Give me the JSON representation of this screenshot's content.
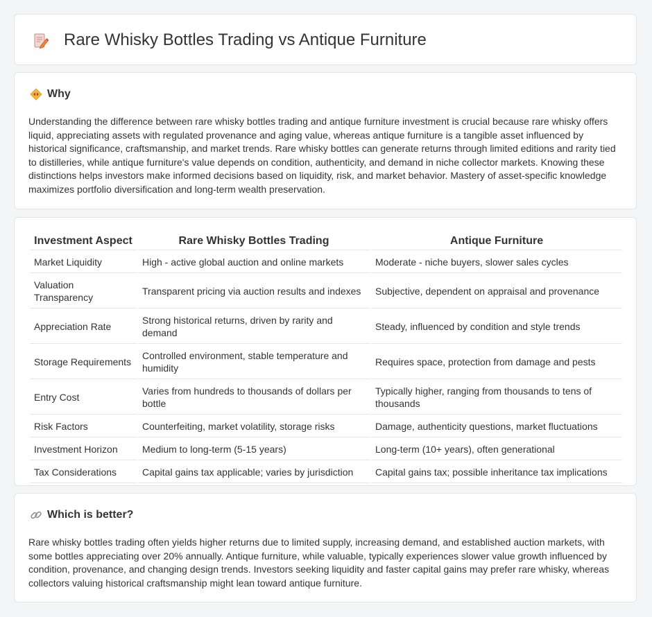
{
  "page": {
    "title": "Rare Whisky Bottles Trading vs Antique Furniture",
    "icon": "document-pencil-icon"
  },
  "why": {
    "heading": "Why",
    "icon": "diamond-arrows-icon",
    "text": "Understanding the difference between rare whisky bottles trading and antique furniture investment is crucial because rare whisky offers liquid, appreciating assets with regulated provenance and aging value, whereas antique furniture is a tangible asset influenced by historical significance, craftsmanship, and market trends. Rare whisky bottles can generate returns through limited editions and rarity tied to distilleries, while antique furniture's value depends on condition, authenticity, and demand in niche collector markets. Knowing these distinctions helps investors make informed decisions based on liquidity, risk, and market behavior. Mastery of asset-specific knowledge maximizes portfolio diversification and long-term wealth preservation."
  },
  "table": {
    "headers": [
      "Investment Aspect",
      "Rare Whisky Bottles Trading",
      "Antique Furniture"
    ],
    "rows": [
      [
        "Market Liquidity",
        "High - active global auction and online markets",
        "Moderate - niche buyers, slower sales cycles"
      ],
      [
        "Valuation Transparency",
        "Transparent pricing via auction results and indexes",
        "Subjective, dependent on appraisal and provenance"
      ],
      [
        "Appreciation Rate",
        "Strong historical returns, driven by rarity and demand",
        "Steady, influenced by condition and style trends"
      ],
      [
        "Storage Requirements",
        "Controlled environment, stable temperature and humidity",
        "Requires space, protection from damage and pests"
      ],
      [
        "Entry Cost",
        "Varies from hundreds to thousands of dollars per bottle",
        "Typically higher, ranging from thousands to tens of thousands"
      ],
      [
        "Risk Factors",
        "Counterfeiting, market volatility, storage risks",
        "Damage, authenticity questions, market fluctuations"
      ],
      [
        "Investment Horizon",
        "Medium to long-term (5-15 years)",
        "Long-term (10+ years), often generational"
      ],
      [
        "Tax Considerations",
        "Capital gains tax applicable; varies by jurisdiction",
        "Capital gains tax; possible inheritance tax implications"
      ]
    ]
  },
  "better": {
    "heading": "Which is better?",
    "icon": "link-icon",
    "text": "Rare whisky bottles trading often yields higher returns due to limited supply, increasing demand, and established auction markets, with some bottles appreciating over 20% annually. Antique furniture, while valuable, typically experiences slower value growth influenced by condition, provenance, and changing design trends. Investors seeking liquidity and faster capital gains may prefer rare whisky, whereas collectors valuing historical craftsmanship might lean toward antique furniture."
  }
}
